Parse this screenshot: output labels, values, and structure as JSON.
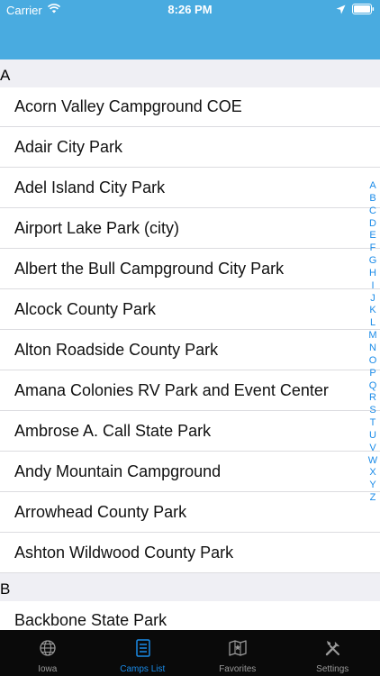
{
  "status_bar": {
    "carrier": "Carrier",
    "time": "8:26 PM"
  },
  "colors": {
    "header": "#49abe0",
    "accent": "#1a8be8",
    "section_bg": "#efeff4",
    "tab_bar": "#0a0a0a"
  },
  "sections": [
    {
      "letter": "A",
      "items": [
        "Acorn Valley Campground COE",
        "Adair City Park",
        "Adel Island City Park",
        "Airport Lake Park (city)",
        "Albert the Bull Campground City Park",
        "Alcock County Park",
        "Alton Roadside County Park",
        "Amana Colonies RV Park and Event Center",
        "Ambrose A. Call State Park",
        "Andy Mountain Campground",
        "Arrowhead County Park",
        "Ashton Wildwood County Park"
      ]
    },
    {
      "letter": "B",
      "items": [
        "Backbone State Park"
      ]
    }
  ],
  "section_index": [
    "A",
    "B",
    "C",
    "D",
    "E",
    "F",
    "G",
    "H",
    "I",
    "J",
    "K",
    "L",
    "M",
    "N",
    "O",
    "P",
    "Q",
    "R",
    "S",
    "T",
    "U",
    "V",
    "W",
    "X",
    "Y",
    "Z"
  ],
  "tabs": [
    {
      "label": "Iowa",
      "icon": "globe-icon",
      "active": false
    },
    {
      "label": "Camps List",
      "icon": "list-icon",
      "active": true
    },
    {
      "label": "Favorites",
      "icon": "map-icon",
      "active": false
    },
    {
      "label": "Settings",
      "icon": "tools-icon",
      "active": false
    }
  ]
}
